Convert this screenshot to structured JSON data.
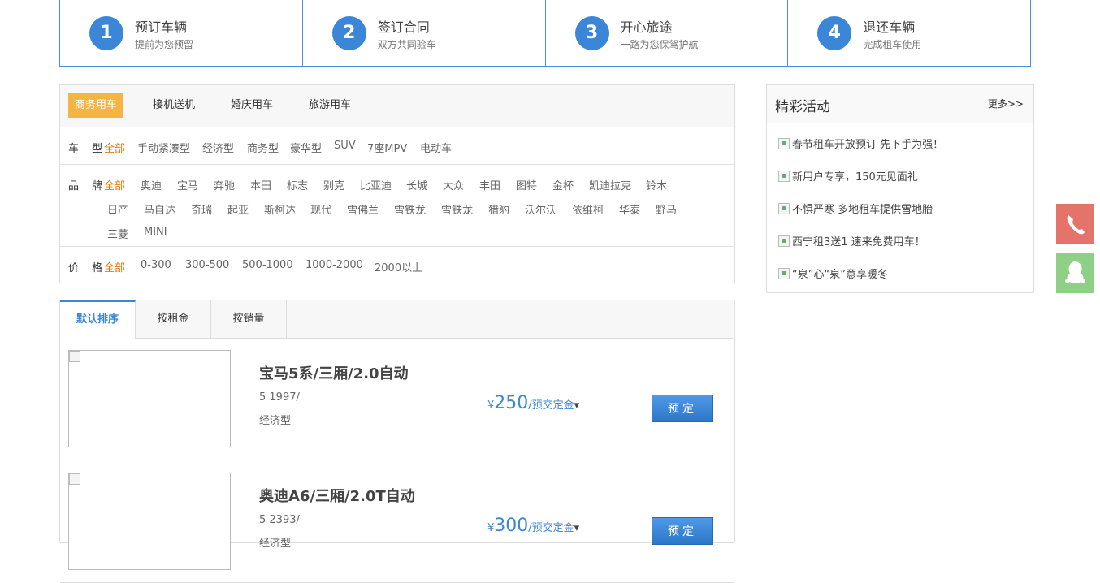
{
  "steps": [
    {
      "num": "1",
      "title": "预订车辆",
      "sub": "提前为您预留"
    },
    {
      "num": "2",
      "title": "签订合同",
      "sub": "双方共同验车"
    },
    {
      "num": "3",
      "title": "开心旅途",
      "sub": "一路为您保驾护航"
    },
    {
      "num": "4",
      "title": "退还车辆",
      "sub": "完成租车使用"
    }
  ],
  "filter": {
    "tabs": [
      "商务用车",
      "接机送机",
      "婚庆用车",
      "旅游用车"
    ],
    "type_label": "车 型",
    "types": [
      "全部",
      "手动紧凑型",
      "经济型",
      "商务型",
      "豪华型",
      "SUV",
      "7座MPV",
      "电动车"
    ],
    "brand_label": "品 牌",
    "brands_row1": [
      "全部",
      "奥迪",
      "宝马",
      "奔驰",
      "本田",
      "标志",
      "别克",
      "比亚迪",
      "长城",
      "大众",
      "丰田",
      "图特",
      "金杯",
      "凯迪拉克",
      "铃木"
    ],
    "brands_row2": [
      "日产",
      "马自达",
      "奇瑞",
      "起亚",
      "斯柯达",
      "现代",
      "雪佛兰",
      "雪铁龙",
      "雪铁龙",
      "猎豹",
      "沃尔沃",
      "依维柯",
      "华泰",
      "野马"
    ],
    "brands_row3": [
      "三菱",
      "MINI"
    ],
    "price_label": "价 格",
    "prices": [
      "全部",
      "0-300",
      "300-500",
      "500-1000",
      "1000-2000",
      "2000以上"
    ]
  },
  "activities": {
    "title": "精彩活动",
    "more": "更多>>",
    "items": [
      "春节租车开放预订 先下手为强！",
      "新用户专享，150元见面礼",
      "不惧严寒 多地租车提供雪地胎",
      "西宁租3送1 速来免费用车！",
      "“泉”心“泉”意享暖冬"
    ]
  },
  "sort": [
    "默认排序",
    "按租金",
    "按销量"
  ],
  "cars": [
    {
      "name": "宝马5系/三厢/2.0自动",
      "spec": "5 1997/",
      "type": "经济型",
      "yen": "¥",
      "price": "250",
      "unit": "/预交定金",
      "arrow": "▾",
      "book": "预定"
    },
    {
      "name": "奥迪A6/三厢/2.0T自动",
      "spec": "5 2393/",
      "type": "经济型",
      "yen": "¥",
      "price": "300",
      "unit": "/预交定金",
      "arrow": "▾",
      "book": "预定"
    }
  ],
  "side": {
    "phone_icon": "phone-icon",
    "qq_icon": "qq-icon"
  },
  "colors": {
    "accent": "#3b86d6",
    "orange": "#e07b12",
    "tab_active": "#f5b544"
  }
}
